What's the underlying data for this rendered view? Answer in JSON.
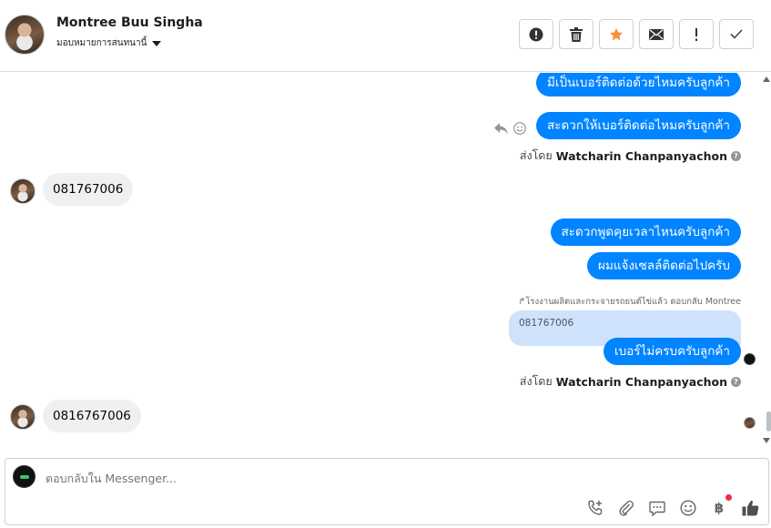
{
  "header": {
    "contact_name": "Montree Buu Singha",
    "assign_label": "มอบหมายการสนทนานี้",
    "actions": [
      {
        "icon": "alert-circle-icon",
        "name": "mark-spam-button"
      },
      {
        "icon": "trash-icon",
        "name": "delete-button"
      },
      {
        "icon": "star-icon",
        "name": "star-button",
        "color": "#f7923b"
      },
      {
        "icon": "envelope-icon",
        "name": "mark-unread-button"
      },
      {
        "icon": "exclamation-icon",
        "name": "follow-up-button"
      },
      {
        "icon": "check-icon",
        "name": "done-button"
      }
    ]
  },
  "thread": {
    "messages": [
      {
        "dir": "out",
        "text": "มีเป็นเบอร์ติดต่อด้วยไหมครับลูกค้า"
      },
      {
        "dir": "out",
        "text": "สะดวกให้เบอร์ติดต่อไหมครับลูกค้า"
      },
      {
        "type": "sender_note",
        "prefix": "ส่งโดย",
        "name": "Watcharin Chanpanyachon"
      },
      {
        "dir": "in",
        "text": "081767006"
      },
      {
        "dir": "out",
        "text": "สะดวกพูดคุยเวลาไหนครับลูกค้า"
      },
      {
        "dir": "out",
        "text": "ผมแจ้งเซลล์ติดต่อไปครับ"
      },
      {
        "type": "reply_context",
        "text": "โรงงานผลิตและกระจายรถยนต์ไข่แล้ว ตอบกลับ Montree"
      },
      {
        "type": "quoted",
        "text": "081767006"
      },
      {
        "dir": "out",
        "text": "เบอร์ไม่ครบครับลูกค้า"
      },
      {
        "type": "sender_note",
        "prefix": "ส่งโดย",
        "name": "Watcharin Chanpanyachon"
      },
      {
        "dir": "in",
        "text": "0816767006"
      }
    ],
    "help_glyph": "?"
  },
  "composer": {
    "placeholder": "ตอบกลับใน Messenger...",
    "tools": [
      "phone-plus-icon",
      "paperclip-icon",
      "saved-reply-icon",
      "emoji-icon",
      "baht-icon",
      "thumbs-up-icon"
    ],
    "baht_symbol": "฿"
  },
  "colors": {
    "outgoing_bubble": "#0084ff",
    "incoming_bubble": "#f0f0f0",
    "quoted_bubble": "#cfe2fb",
    "badge": "#f02849"
  }
}
